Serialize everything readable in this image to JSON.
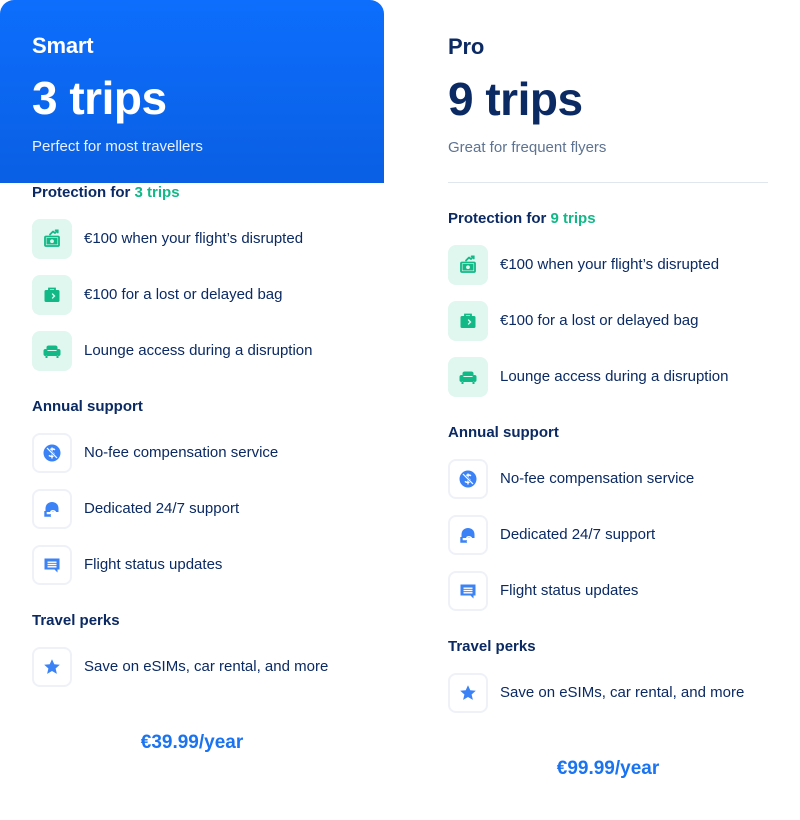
{
  "colors": {
    "brand_blue": "#0d6efd",
    "accent_green": "#12b886",
    "navy_text": "#0b2a63",
    "price_blue": "#1a73f0",
    "green_tile": "#dff7ee",
    "support_icon_blue": "#3b82f6"
  },
  "plans": [
    {
      "name": "Smart",
      "trips": "3 trips",
      "tagline": "Perfect for most travellers",
      "highlighted": true,
      "sections": [
        {
          "title_prefix": "Protection for ",
          "title_accent": "3 trips",
          "features": [
            {
              "icon": "money-arrow-icon",
              "label": "€100 when your flight’s disrupted"
            },
            {
              "icon": "suitcase-icon",
              "label": "€100 for a lost or delayed bag"
            },
            {
              "icon": "armchair-icon",
              "label": "Lounge access during a disruption"
            }
          ]
        },
        {
          "title_prefix": "Annual support",
          "title_accent": "",
          "features": [
            {
              "icon": "no-fee-icon",
              "label": "No-fee compensation service"
            },
            {
              "icon": "headset-icon",
              "label": "Dedicated 24/7 support"
            },
            {
              "icon": "message-icon",
              "label": "Flight status updates"
            }
          ]
        },
        {
          "title_prefix": "Travel perks",
          "title_accent": "",
          "features": [
            {
              "icon": "star-icon",
              "label": "Save on eSIMs, car rental, and more"
            }
          ]
        }
      ],
      "price": "€39.99/year"
    },
    {
      "name": "Pro",
      "trips": "9 trips",
      "tagline": "Great for frequent flyers",
      "highlighted": false,
      "sections": [
        {
          "title_prefix": "Protection for ",
          "title_accent": "9 trips",
          "features": [
            {
              "icon": "money-arrow-icon",
              "label": "€100 when your flight’s disrupted"
            },
            {
              "icon": "suitcase-icon",
              "label": "€100 for a lost or delayed bag"
            },
            {
              "icon": "armchair-icon",
              "label": "Lounge access during a disruption"
            }
          ]
        },
        {
          "title_prefix": "Annual support",
          "title_accent": "",
          "features": [
            {
              "icon": "no-fee-icon",
              "label": "No-fee compensation service"
            },
            {
              "icon": "headset-icon",
              "label": "Dedicated 24/7 support"
            },
            {
              "icon": "message-icon",
              "label": "Flight status updates"
            }
          ]
        },
        {
          "title_prefix": "Travel perks",
          "title_accent": "",
          "features": [
            {
              "icon": "star-icon",
              "label": "Save on eSIMs, car rental, and more"
            }
          ]
        }
      ],
      "price": "€99.99/year"
    }
  ]
}
